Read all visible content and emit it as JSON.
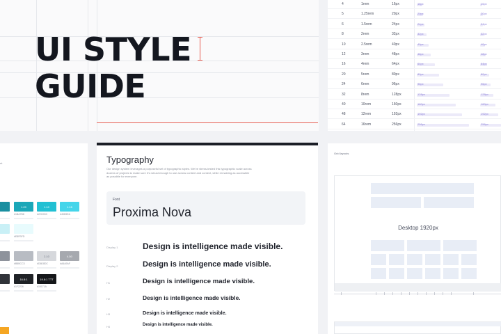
{
  "hero": {
    "title_line1": "UI STYLE",
    "title_line2": "GUIDE"
  },
  "spacing": {
    "rows": [
      {
        "base": "4",
        "rem": "1rem",
        "px": "16px",
        "bar": 0.1
      },
      {
        "base": "5",
        "rem": "1.25rem",
        "px": "20px",
        "bar": 0.12
      },
      {
        "base": "6",
        "rem": "1.5rem",
        "px": "24px",
        "bar": 0.14
      },
      {
        "base": "8",
        "rem": "2rem",
        "px": "32px",
        "bar": 0.18
      },
      {
        "base": "10",
        "rem": "2.5rem",
        "px": "40px",
        "bar": 0.22
      },
      {
        "base": "12",
        "rem": "3rem",
        "px": "48px",
        "bar": 0.26
      },
      {
        "base": "16",
        "rem": "4rem",
        "px": "64px",
        "bar": 0.34
      },
      {
        "base": "20",
        "rem": "5rem",
        "px": "80px",
        "bar": 0.42
      },
      {
        "base": "24",
        "rem": "6rem",
        "px": "96px",
        "bar": 0.5
      },
      {
        "base": "32",
        "rem": "8rem",
        "px": "128px",
        "bar": 0.62
      },
      {
        "base": "40",
        "rem": "10rem",
        "px": "160px",
        "bar": 0.74
      },
      {
        "base": "48",
        "rem": "12rem",
        "px": "192px",
        "bar": 0.86
      },
      {
        "base": "64",
        "rem": "16rem",
        "px": "256px",
        "bar": 1.0
      }
    ]
  },
  "colors": {
    "swatches": [
      {
        "color": "#1a8fa0",
        "label": "",
        "sub": ""
      },
      {
        "color": "#1ba7b8",
        "label": "1.20",
        "sub": "#1BA7B8"
      },
      {
        "color": "#22c0d3",
        "label": "1.10",
        "sub": "#22C0D3"
      },
      {
        "color": "#45d5ea",
        "label": "1.15",
        "sub": "#45D5EA"
      },
      {
        "color": "#c9f0f6",
        "label": "",
        "sub": ""
      },
      {
        "color": "#e8fbfd",
        "label": "",
        "sub": "#E8FBFD"
      },
      {
        "color": "#8e939c",
        "label": "",
        "sub": ""
      },
      {
        "color": "#b8bcc3",
        "label": "",
        "sub": "#B8BCC3"
      },
      {
        "color": "#d6d8dc",
        "label": "2.10",
        "sub": "#D6D8DC"
      },
      {
        "color": "#a6a9af",
        "label": "4.50",
        "sub": "#A6A9AF"
      },
      {
        "color": "#303339",
        "label": "",
        "sub": ""
      },
      {
        "color": "#1f2226",
        "label": "16.8:1",
        "sub": "#1F2226"
      },
      {
        "color": "#15171a",
        "label": "19.8:1 TTT",
        "sub": "#15171A"
      }
    ]
  },
  "typography": {
    "title": "Typography",
    "description": "Our design system leverages a purposeful set of typographic styles. We've stress-tested this typographic scale across dozens of projects to make sure it's robust enough to use across content and context, while remaining as accessible as possible for everyone.",
    "font_label": "Font",
    "font_name": "Proxima Nova",
    "samples": [
      {
        "label": "Display 1",
        "text": "Design is intelligence made visible."
      },
      {
        "label": "Display 2",
        "text": "Design is intelligence made visible."
      },
      {
        "label": "H1",
        "text": "Design is intelligence made visible."
      },
      {
        "label": "H2",
        "text": "Design is intelligence made visible."
      },
      {
        "label": "H3",
        "text": "Design is intelligence made visible."
      },
      {
        "label": "H4",
        "text": "Design is intelligence made visible."
      }
    ]
  },
  "grid": {
    "title": "Grid layouts",
    "caption": "Desktop 1920px"
  }
}
